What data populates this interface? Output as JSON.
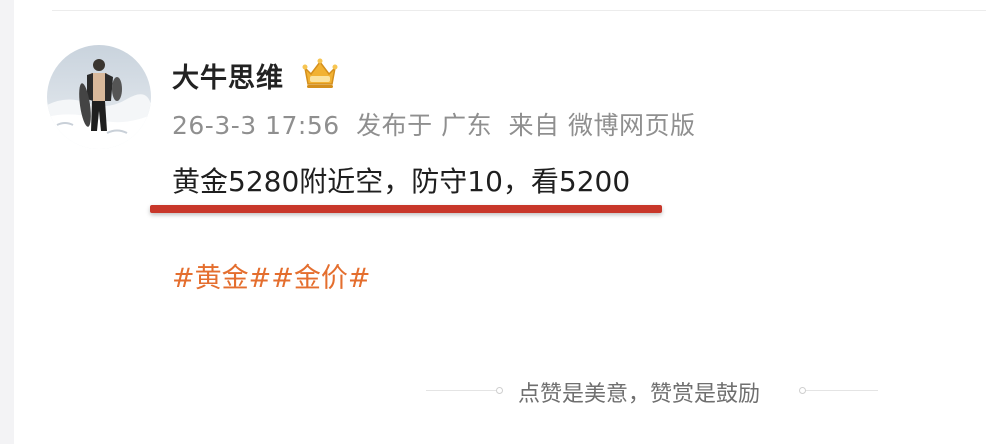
{
  "post": {
    "username": "大牛思维",
    "badge_icon": "crown-vip-icon",
    "meta": {
      "timestamp": "26-3-3 17:56",
      "published_in": "发布于 广东",
      "source": "来自 微博网页版"
    },
    "text": "黄金5280附近空，防守10，看5200",
    "hashtags": [
      "#黄金#",
      "#金价#"
    ],
    "appreciate_text": "点赞是美意，赞赏是鼓励"
  },
  "colors": {
    "hashtag": "#e46e2e",
    "underline_mark": "#c8372a",
    "meta_text": "#8f8f8f",
    "badge_gold": "#f2b233"
  }
}
